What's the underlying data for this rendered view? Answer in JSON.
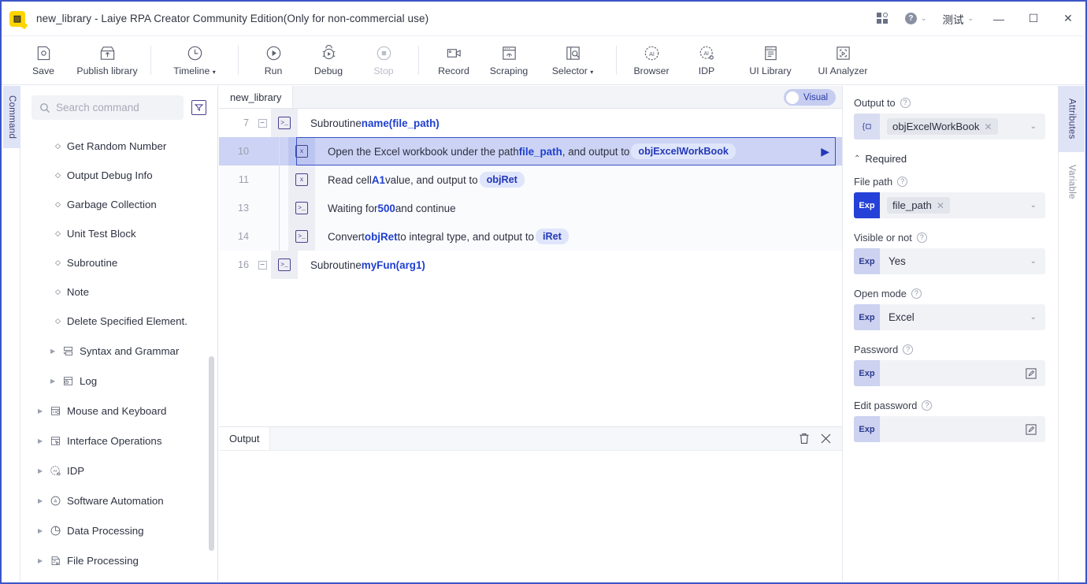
{
  "titlebar": {
    "app_icon": "laiye-logo-icon",
    "title": "new_library - Laiye RPA Creator Community Edition(Only for non-commercial use)",
    "grid_icon": "apps-grid-icon",
    "help_icon": "help-circle-icon",
    "help_caret": "⌄",
    "user": "测试",
    "user_caret": "⌄",
    "minimize": "—",
    "maximize": "☐",
    "close": "✕"
  },
  "toolbar": {
    "groups": [
      {
        "items": [
          {
            "label": "Save",
            "icon": "save-disk-icon",
            "disabled": false,
            "wide": false
          },
          {
            "label": "Publish library",
            "icon": "publish-box-icon",
            "disabled": false,
            "wide": true
          }
        ]
      },
      {
        "items": [
          {
            "label": "Timeline",
            "icon": "clock-icon",
            "disabled": false,
            "wide": true,
            "dropdown": true
          }
        ]
      },
      {
        "items": [
          {
            "label": "Run",
            "icon": "play-circle-icon",
            "disabled": false,
            "wide": false
          },
          {
            "label": "Debug",
            "icon": "bug-play-icon",
            "disabled": false,
            "wide": false
          },
          {
            "label": "Stop",
            "icon": "stop-circle-icon",
            "disabled": true,
            "wide": false
          }
        ]
      },
      {
        "items": [
          {
            "label": "Record",
            "icon": "camera-record-icon",
            "disabled": false,
            "wide": false
          },
          {
            "label": "Scraping",
            "icon": "scraping-window-icon",
            "disabled": false,
            "wide": false
          },
          {
            "label": "Selector",
            "icon": "selector-search-icon",
            "disabled": false,
            "wide": true,
            "dropdown": true
          }
        ]
      },
      {
        "items": [
          {
            "label": "Browser",
            "icon": "ai-browser-icon",
            "disabled": false,
            "wide": false
          },
          {
            "label": "IDP",
            "icon": "ai-idp-icon",
            "disabled": false,
            "wide": false
          },
          {
            "label": "UI Library",
            "icon": "ui-library-icon",
            "disabled": false,
            "wide": true
          },
          {
            "label": "UI Analyzer",
            "icon": "ui-analyzer-icon",
            "disabled": false,
            "wide": true
          }
        ]
      }
    ]
  },
  "left_rail": {
    "tab": "Command"
  },
  "command_panel": {
    "search": {
      "placeholder": "Search command",
      "icon": "search-icon",
      "value": ""
    },
    "filter_icon": "filter-dropdown-icon",
    "leaves": [
      "Get Random Number",
      "Output Debug Info",
      "Garbage Collection",
      "Unit Test Block",
      "Subroutine",
      "Note",
      "Delete Specified Element."
    ],
    "nodes": [
      {
        "label": "Syntax and Grammar",
        "level": 2,
        "icon": "syntax-blocks-icon"
      },
      {
        "label": "Log",
        "level": 2,
        "icon": "log-icon"
      },
      {
        "label": "Mouse and Keyboard",
        "level": 1,
        "icon": "mouse-keyboard-icon"
      },
      {
        "label": "Interface Operations",
        "level": 1,
        "icon": "interface-ops-icon"
      },
      {
        "label": "IDP",
        "level": 1,
        "icon": "ai-idp-icon"
      },
      {
        "label": "Software Automation",
        "level": 1,
        "icon": "automation-circle-icon"
      },
      {
        "label": "Data Processing",
        "level": 1,
        "icon": "pie-data-icon"
      },
      {
        "label": "File Processing",
        "level": 1,
        "icon": "file-process-icon"
      }
    ]
  },
  "editor": {
    "tab": "new_library",
    "toggle": {
      "label": "Visual",
      "on": false
    },
    "rows": [
      {
        "line": "7",
        "kind": "subroutine",
        "foldable": true,
        "fold": "−",
        "icon": "terminal-command-icon",
        "selected": false,
        "indent": false,
        "parts": [
          {
            "t": "Subroutine ",
            "s": "plain"
          },
          {
            "t": "name(file_path)",
            "s": "bold"
          }
        ]
      },
      {
        "line": "10",
        "kind": "statement",
        "foldable": false,
        "icon": "excel-file-icon",
        "selected": true,
        "indent": true,
        "has_play": true,
        "play_icon": "run-step-triangle-icon",
        "parts": [
          {
            "t": "Open the Excel workbook under the path ",
            "s": "plain"
          },
          {
            "t": "file_path",
            "s": "bold"
          },
          {
            "t": " , and output to ",
            "s": "plain"
          },
          {
            "t": "objExcelWorkBook",
            "s": "chip"
          }
        ]
      },
      {
        "line": "11",
        "kind": "statement",
        "foldable": false,
        "icon": "excel-file-icon",
        "selected": false,
        "indent": true,
        "parts": [
          {
            "t": "Read cell ",
            "s": "plain"
          },
          {
            "t": "A1",
            "s": "bold"
          },
          {
            "t": " value, and output to ",
            "s": "plain"
          },
          {
            "t": "objRet",
            "s": "chip"
          }
        ]
      },
      {
        "line": "13",
        "kind": "statement",
        "foldable": false,
        "icon": "terminal-command-icon",
        "selected": false,
        "indent": true,
        "parts": [
          {
            "t": "Waiting for ",
            "s": "plain"
          },
          {
            "t": "500",
            "s": "bold"
          },
          {
            "t": " and continue",
            "s": "plain"
          }
        ]
      },
      {
        "line": "14",
        "kind": "statement",
        "foldable": false,
        "icon": "terminal-command-icon",
        "selected": false,
        "indent": true,
        "parts": [
          {
            "t": "Convert ",
            "s": "plain"
          },
          {
            "t": "objRet",
            "s": "bold"
          },
          {
            "t": " to integral type, and output to ",
            "s": "plain"
          },
          {
            "t": "iRet",
            "s": "chip"
          }
        ]
      },
      {
        "line": "16",
        "kind": "subroutine",
        "foldable": true,
        "fold": "−",
        "icon": "terminal-command-icon",
        "selected": false,
        "indent": false,
        "parts": [
          {
            "t": "Subroutine ",
            "s": "plain"
          },
          {
            "t": "myFun(arg1)",
            "s": "bold"
          }
        ]
      }
    ]
  },
  "output_panel": {
    "tab": "Output",
    "clear_icon": "trash-icon",
    "close_icon": "close-icon",
    "content": ""
  },
  "properties": {
    "fields": [
      {
        "label": "Output to",
        "help": "?",
        "tag": "",
        "tag_style": "icon",
        "tag_icon": "variable-link-icon",
        "value": "objExcelWorkBook",
        "value_style": "chip",
        "trailing": "chevron",
        "removable": true
      }
    ],
    "section": {
      "label": "Required",
      "collapse_caret": "⌃",
      "expanded": true
    },
    "required_fields": [
      {
        "label": "File path",
        "help": "?",
        "tag": "Exp",
        "tag_style": "solid",
        "value": "file_path",
        "value_style": "chip",
        "trailing": "chevron",
        "removable": true
      },
      {
        "label": "Visible or not",
        "help": "?",
        "tag": "Exp",
        "tag_style": "light",
        "value": "Yes",
        "value_style": "plain",
        "trailing": "chevron",
        "removable": false
      },
      {
        "label": "Open mode",
        "help": "?",
        "tag": "Exp",
        "tag_style": "light",
        "value": "Excel",
        "value_style": "plain",
        "trailing": "chevron",
        "removable": false
      },
      {
        "label": "Password",
        "help": "?",
        "tag": "Exp",
        "tag_style": "light",
        "value": "",
        "value_style": "plain",
        "trailing": "pen",
        "removable": false
      },
      {
        "label": "Edit password",
        "help": "?",
        "tag": "Exp",
        "tag_style": "light",
        "value": "",
        "value_style": "plain",
        "trailing": "pen",
        "removable": false
      }
    ]
  },
  "right_rail": {
    "tabs": [
      {
        "label": "Attributes",
        "active": true
      },
      {
        "label": "Variable",
        "active": false
      }
    ]
  },
  "colors": {
    "accent": "#2541d8",
    "selection_bg": "#ccd3f4",
    "selection_border": "#3a52c6",
    "rail_active": "#dfe3f6",
    "chip_bg": "#dfe5fb",
    "app_icon": "#ffd500"
  }
}
